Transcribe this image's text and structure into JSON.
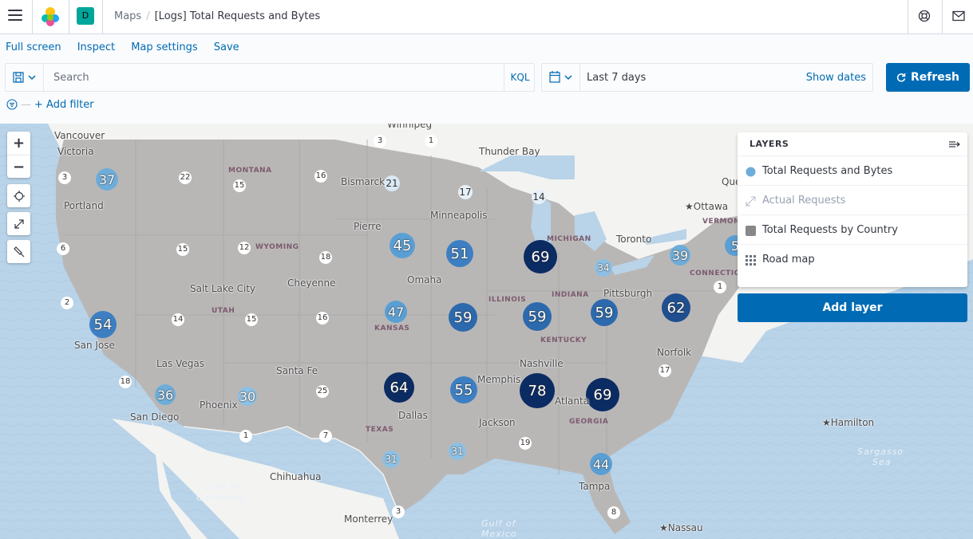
{
  "header": {
    "space_initial": "D",
    "breadcrumb_parent": "Maps",
    "breadcrumb_current": "[Logs] Total Requests and Bytes"
  },
  "topnav": {
    "full_screen": "Full screen",
    "inspect": "Inspect",
    "map_settings": "Map settings",
    "save": "Save"
  },
  "query": {
    "placeholder": "Search",
    "language": "KQL"
  },
  "date": {
    "range": "Last 7 days",
    "show_dates": "Show dates"
  },
  "refresh_label": "Refresh",
  "filters": {
    "add_filter": "+ Add filter"
  },
  "layers": {
    "title": "LAYERS",
    "items": [
      {
        "label": "Total Requests and Bytes",
        "icon": "blue-circle-icon",
        "color": "#6eadd9"
      },
      {
        "label": "Actual Requests",
        "icon": "resize-arrow-icon"
      },
      {
        "label": "Total Requests by Country",
        "icon": "grey-square-icon",
        "color": "#888888"
      },
      {
        "label": "Road map",
        "icon": "grid-icon"
      }
    ],
    "add_layer": "Add layer"
  },
  "map": {
    "clusters": [
      {
        "count": "37"
      },
      {
        "count": "54"
      },
      {
        "count": "36"
      },
      {
        "count": "30"
      },
      {
        "count": "45"
      },
      {
        "count": "47"
      },
      {
        "count": "51"
      },
      {
        "count": "69"
      },
      {
        "count": "59"
      },
      {
        "count": "59"
      },
      {
        "count": "59"
      },
      {
        "count": "62"
      },
      {
        "count": "34"
      },
      {
        "count": "39"
      },
      {
        "count": "5"
      },
      {
        "count": "64"
      },
      {
        "count": "55"
      },
      {
        "count": "78"
      },
      {
        "count": "69"
      },
      {
        "count": "44"
      },
      {
        "count": "31"
      },
      {
        "count": "31"
      },
      {
        "count": "21"
      },
      {
        "count": "17"
      },
      {
        "count": "14"
      }
    ],
    "small_counts": [
      "3",
      "1",
      "3",
      "22",
      "16",
      "15",
      "21",
      "6",
      "15",
      "12",
      "18",
      "2",
      "14",
      "15",
      "16",
      "18",
      "25",
      "1",
      "7",
      "19",
      "17",
      "1",
      "8",
      "3"
    ],
    "places": [
      "Vancouver",
      "Victoria",
      "Portland",
      "Salt Lake City",
      "Cheyenne",
      "Bismarck",
      "Pierre",
      "Minneapolis",
      "Omaha",
      "Thunder Bay",
      "Ottawa",
      "Toronto",
      "Pittsburgh",
      "Norfolk",
      "Nashville",
      "Memphis",
      "Atlanta",
      "Jackson",
      "Dallas",
      "Las Vegas",
      "San Jose",
      "San Diego",
      "Phoenix",
      "Santa Fe",
      "Chihuahua",
      "Monterrey",
      "Tampa",
      "Hamilton",
      "Nassau",
      "Winnipeg",
      "Que"
    ],
    "states": [
      "MONTANA",
      "WYOMING",
      "UTAH",
      "KANSAS",
      "TEXAS",
      "ILLINOIS",
      "INDIANA",
      "KENTUCKY",
      "MICHIGAN",
      "GEORGIA",
      "CONNECTICUT",
      "VERMON"
    ],
    "water": [
      "Gulf of",
      "California",
      "Gulf of",
      "Mexico",
      "Sargasso",
      "Sea"
    ]
  }
}
